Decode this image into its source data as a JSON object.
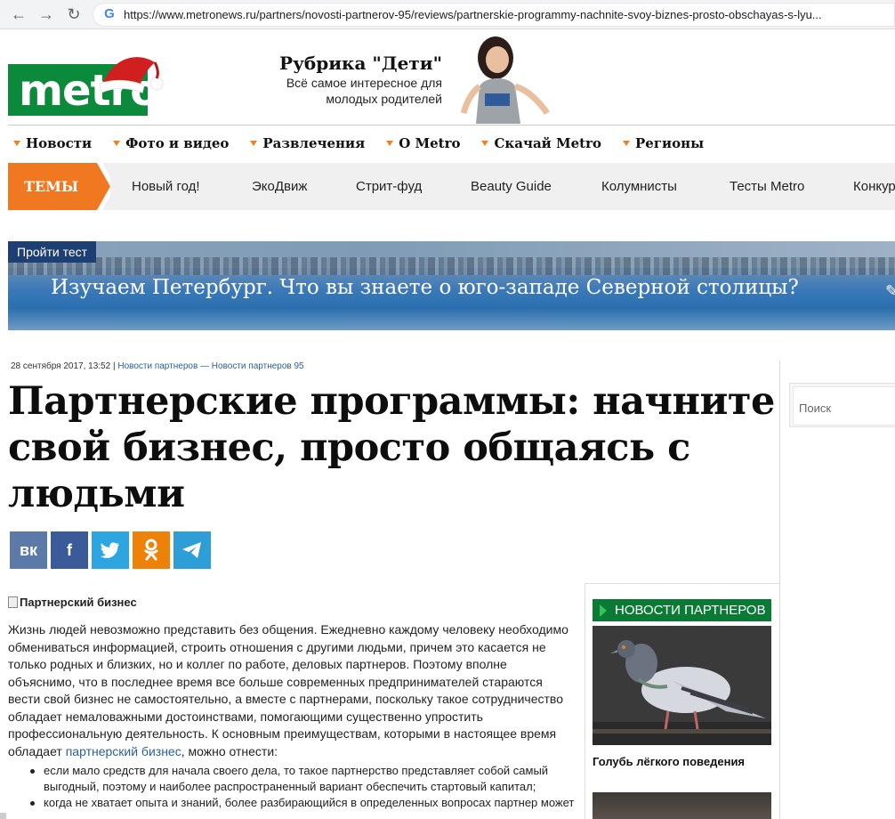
{
  "browser": {
    "url_prefix": "https://",
    "url_host": "www.metronews.ru",
    "url_path": "/partners/novosti-partnerov-95/reviews/partnerskie-programmy-nachnite-svoy-biznes-prosto-obschayas-s-lyu..."
  },
  "header": {
    "logo_text": "metro",
    "promo_title": "Рубрика \"Дети\"",
    "promo_subtitle": "Всё самое интересное для молодых родителей"
  },
  "main_nav": [
    "Новости",
    "Фото и видео",
    "Развлечения",
    "О Metro",
    "Скачай Metro",
    "Регионы"
  ],
  "themes": {
    "label": "ТЕМЫ",
    "items": [
      "Новый год!",
      "ЭкоДвиж",
      "Стрит-фуд",
      "Beauty Guide",
      "Колумнисты",
      "Тесты Metro",
      "Конкур"
    ]
  },
  "banner": {
    "badge": "Пройти тест",
    "text": "Изучаем Петербург. Что вы знаете о юго-западе Северной столицы?"
  },
  "article": {
    "date": "28 сентября 2017, 13:52 | ",
    "category": "Новости партнеров — Новости партнеров 95",
    "title": "Партнерские программы: начните свой бизнес, просто общаясь с людьми",
    "image_alt": "Партнерский бизнес",
    "paragraph_before_link": "Жизнь людей невозможно представить без общения. Ежедневно каждому человеку необходимо обмениваться информацией, строить отношения с другими людьми, причем это касается не только родных и близких, но и коллег по работе, деловых партнеров. Поэтому вполне объяснимо, что в последнее время все больше современных предпринимателей стараются вести свой бизнес не самостоятельно, а вместе с партнерами, поскольку такое сотрудничество обладает немаловажными достоинствами, помогающими существенно упростить профессиональную деятельность. К основным преимуществам, которыми в настоящее время обладает ",
    "paragraph_link": "партнерский бизнес",
    "paragraph_after_link": ", можно отнести:",
    "bullets": [
      "если мало средств для начала своего дела, то такое партнерство представляет собой самый выгодный, поэтому и наиболее распространенный вариант обеспечить стартовый капитал;",
      "когда не хватает опыта и знаний, более разбирающийся в определенных вопросах партнер может"
    ]
  },
  "share": {
    "vk": "вк",
    "facebook": "f",
    "twitter": "t",
    "odnoklassniki": "ок",
    "telegram": "tg",
    "colors": {
      "vk": "#5b7aa7",
      "facebook": "#3b5a9a",
      "twitter": "#2ca5e0",
      "odnoklassniki": "#ee8208",
      "telegram": "#2e9fd6"
    }
  },
  "partner_news": {
    "heading": "НОВОСТИ ПАРТНЕРОВ",
    "item_caption": "Голубь лёгкого поведения"
  },
  "sidebar": {
    "search_placeholder": "Поиск"
  },
  "colors": {
    "metro_green": "#0a8a3a",
    "themes_orange": "#f07820",
    "link_blue": "#2a5f9e",
    "nav_triangle": "#f08020"
  }
}
